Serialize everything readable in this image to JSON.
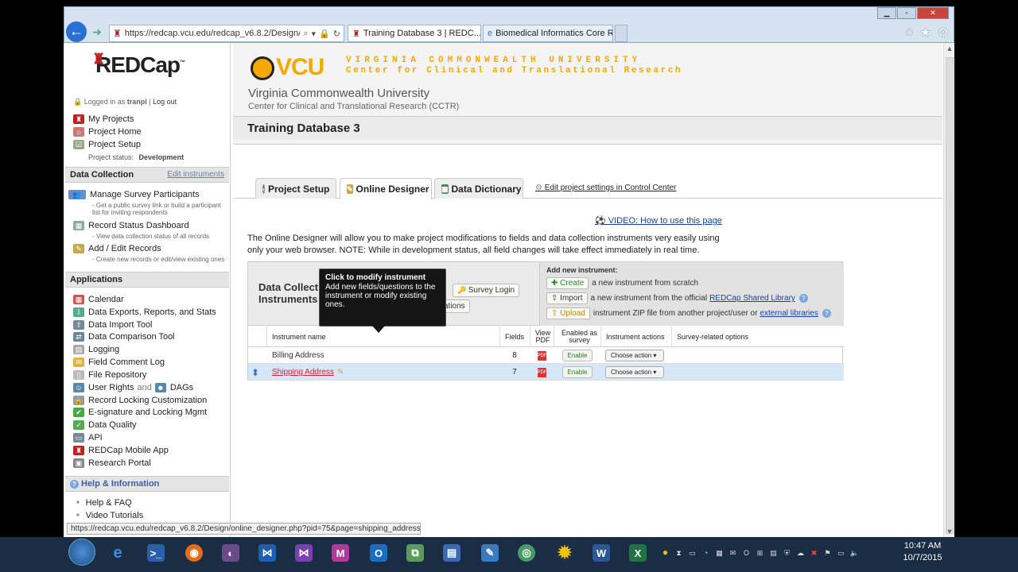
{
  "browser": {
    "url": "https://redcap.vcu.edu/redcap_v6.8.2/Design/c",
    "tabs": [
      {
        "label": "Training Database 3 | REDC..."
      },
      {
        "label": "Biomedical Informatics Core R..."
      }
    ],
    "status_url": "https://redcap.vcu.edu/redcap_v6.8.2/Design/online_designer.php?pid=75&page=shipping_address"
  },
  "sidebar": {
    "logo": "REDCap",
    "logo_tm": "™",
    "logged_in_prefix": "Logged in as",
    "username": "tranpl",
    "logout": "Log out",
    "top_items": [
      "My Projects",
      "Project Home",
      "Project Setup"
    ],
    "project_status_label": "Project status:",
    "project_status_value": "Development",
    "data_collection": {
      "title": "Data Collection",
      "edit_link": "Edit instruments",
      "items": [
        {
          "label": "Manage Survey Participants",
          "sub": "- Get a public survey link or build a participant list for inviting respondents"
        },
        {
          "label": "Record Status Dashboard",
          "sub": "- View data collection status of all records"
        },
        {
          "label": "Add / Edit Records",
          "sub": "- Create new records or edit/view existing ones"
        }
      ]
    },
    "applications": {
      "title": "Applications",
      "items": [
        "Calendar",
        "Data Exports, Reports, and Stats",
        "Data Import Tool",
        "Data Comparison Tool",
        "Logging",
        "Field Comment Log",
        "File Repository",
        "User Rights",
        "Record Locking Customization",
        "E-signature and Locking Mgmt",
        "Data Quality",
        "API",
        "REDCap Mobile App",
        "Research Portal"
      ],
      "user_rights_and": "and",
      "dags": "DAGs"
    },
    "help": {
      "title": "Help & Information",
      "items": [
        "Help & FAQ",
        "Video Tutorials"
      ]
    }
  },
  "header": {
    "vcu_logo": "VCU",
    "vcu_tag_line1": "VIRGINIA COMMONWEALTH UNIVERSITY",
    "vcu_tag_line2": "Center for Clinical and Translational Research",
    "university": "Virginia Commonwealth University",
    "center": "Center for Clinical and Translational Research (CCTR)",
    "project_title": "Training Database 3"
  },
  "tabs": [
    {
      "label": "Project Setup"
    },
    {
      "label": "Online Designer"
    },
    {
      "label": "Data Dictionary"
    }
  ],
  "control_center_link": "Edit project settings in Control Center",
  "video_link": "VIDEO: How to use this page",
  "intro_text": "The Online Designer will allow you to make project modifications to fields and data collection instruments very easily using only your web browser. NOTE: While in development status, all field changes will take effect immediately in real time.",
  "instruments": {
    "title_line1": "Data Collect",
    "title_line2": "Instruments",
    "survey_login": "Survey Login",
    "hidden_btn": "ations",
    "add_new_label": "Add new instrument:",
    "create_btn": "Create",
    "create_text": "a new instrument from scratch",
    "import_btn": "Import",
    "import_text": "a new instrument from the official",
    "shared_library": "REDCap Shared Library",
    "upload_btn": "Upload",
    "upload_text": "instrument ZIP file from another project/user or",
    "external_libraries": "external libraries",
    "columns": [
      "Instrument name",
      "Fields",
      "View PDF",
      "Enabled as survey",
      "Instrument actions",
      "Survey-related options"
    ],
    "rows": [
      {
        "name": "Billing Address",
        "fields": "8",
        "enable": "Enable",
        "action": "Choose action"
      },
      {
        "name": "Shipping Address",
        "fields": "7",
        "enable": "Enable",
        "action": "Choose action"
      }
    ]
  },
  "tooltip": {
    "title": "Click to modify instrument",
    "body": "Add new fields/questions to the instrument or modify existing ones."
  },
  "taskbar": {
    "time": "10:47 AM",
    "date": "10/7/2015"
  }
}
